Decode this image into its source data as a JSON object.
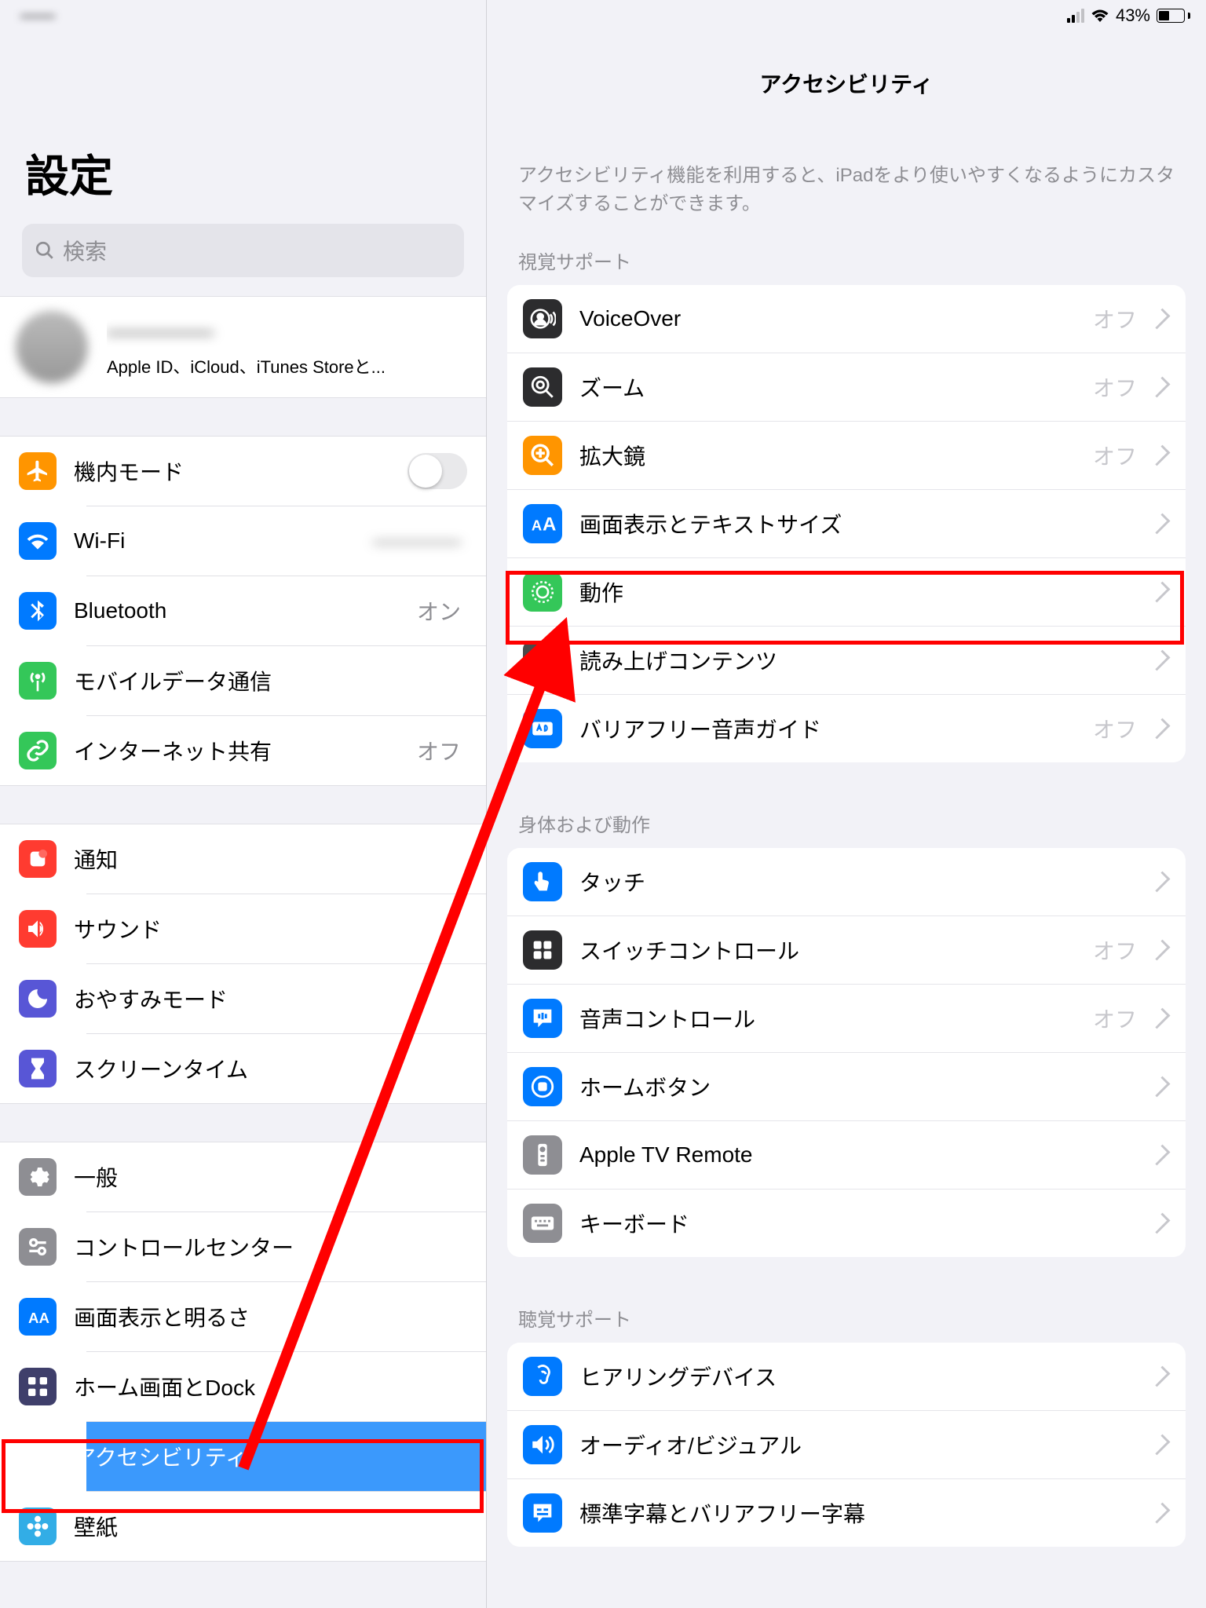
{
  "status": {
    "time": "——",
    "battery_pct": "43%"
  },
  "sidebar": {
    "title": "設定",
    "search_placeholder": "検索",
    "account": {
      "name": "————",
      "subtitle": "Apple ID、iCloud、iTunes Storeと..."
    },
    "groups": [
      {
        "items": [
          {
            "key": "airplane",
            "label": "機内モード",
            "icon": "airplane-icon",
            "color": "ic-orange",
            "type": "toggle"
          },
          {
            "key": "wifi",
            "label": "Wi-Fi",
            "icon": "wifi-icon",
            "color": "ic-blue",
            "value": "————",
            "value_blur": true
          },
          {
            "key": "bluetooth",
            "label": "Bluetooth",
            "icon": "bluetooth-icon",
            "color": "ic-blue",
            "value": "オン"
          },
          {
            "key": "cellular",
            "label": "モバイルデータ通信",
            "icon": "antenna-icon",
            "color": "ic-green"
          },
          {
            "key": "hotspot",
            "label": "インターネット共有",
            "icon": "link-icon",
            "color": "ic-green",
            "value": "オフ"
          }
        ]
      },
      {
        "items": [
          {
            "key": "notifications",
            "label": "通知",
            "icon": "bell-icon",
            "color": "ic-red"
          },
          {
            "key": "sound",
            "label": "サウンド",
            "icon": "speaker-icon",
            "color": "ic-red"
          },
          {
            "key": "dnd",
            "label": "おやすみモード",
            "icon": "moon-icon",
            "color": "ic-purple"
          },
          {
            "key": "screentime",
            "label": "スクリーンタイム",
            "icon": "hourglass-icon",
            "color": "ic-purple"
          }
        ]
      },
      {
        "items": [
          {
            "key": "general",
            "label": "一般",
            "icon": "gear-icon",
            "color": "ic-gray"
          },
          {
            "key": "controlcenter",
            "label": "コントロールセンター",
            "icon": "switches-icon",
            "color": "ic-gray"
          },
          {
            "key": "display",
            "label": "画面表示と明るさ",
            "icon": "text-icon",
            "color": "ic-blue"
          },
          {
            "key": "home",
            "label": "ホーム画面とDock",
            "icon": "grid-icon",
            "color": "ic-navy"
          },
          {
            "key": "accessibility",
            "label": "アクセシビリティ",
            "icon": "person-icon",
            "color": "ic-blue",
            "selected": true
          },
          {
            "key": "wallpaper",
            "label": "壁紙",
            "icon": "flower-icon",
            "color": "ic-teal"
          }
        ]
      }
    ]
  },
  "main": {
    "title": "アクセシビリティ",
    "description": "アクセシビリティ機能を利用すると、iPadをより使いやすくなるようにカスタマイズすることができます。",
    "groups": [
      {
        "header": "視覚サポート",
        "items": [
          {
            "key": "voiceover",
            "label": "VoiceOver",
            "icon": "voiceover-icon",
            "color": "ic-black",
            "value": "オフ"
          },
          {
            "key": "zoom",
            "label": "ズーム",
            "icon": "zoom-icon",
            "color": "ic-black",
            "value": "オフ"
          },
          {
            "key": "magnifier",
            "label": "拡大鏡",
            "icon": "magnifier-icon",
            "color": "ic-orange",
            "value": "オフ"
          },
          {
            "key": "textsize",
            "label": "画面表示とテキストサイズ",
            "icon": "textsize-icon",
            "color": "ic-blue"
          },
          {
            "key": "motion",
            "label": "動作",
            "icon": "motion-icon",
            "color": "ic-green",
            "highlight": true
          },
          {
            "key": "spoken",
            "label": "読み上げコンテンツ",
            "icon": "speech-icon",
            "color": "ic-darkgray"
          },
          {
            "key": "audiodesc",
            "label": "バリアフリー音声ガイド",
            "icon": "audio-desc-icon",
            "color": "ic-blue",
            "value": "オフ"
          }
        ]
      },
      {
        "header": "身体および動作",
        "items": [
          {
            "key": "touch",
            "label": "タッチ",
            "icon": "touch-icon",
            "color": "ic-blue"
          },
          {
            "key": "switch",
            "label": "スイッチコントロール",
            "icon": "switch-icon",
            "color": "ic-black",
            "value": "オフ"
          },
          {
            "key": "voice",
            "label": "音声コントロール",
            "icon": "voice-icon",
            "color": "ic-blue",
            "value": "オフ"
          },
          {
            "key": "homebtn",
            "label": "ホームボタン",
            "icon": "home-btn-icon",
            "color": "ic-blue"
          },
          {
            "key": "appletv",
            "label": "Apple TV Remote",
            "icon": "remote-icon",
            "color": "ic-gray"
          },
          {
            "key": "keyboard",
            "label": "キーボード",
            "icon": "keyboard-icon",
            "color": "ic-gray"
          }
        ]
      },
      {
        "header": "聴覚サポート",
        "items": [
          {
            "key": "hearing",
            "label": "ヒアリングデバイス",
            "icon": "ear-icon",
            "color": "ic-blue"
          },
          {
            "key": "audioviz",
            "label": "オーディオ/ビジュアル",
            "icon": "av-icon",
            "color": "ic-blue"
          },
          {
            "key": "captions",
            "label": "標準字幕とバリアフリー字幕",
            "icon": "caption-icon",
            "color": "ic-blue"
          }
        ]
      }
    ]
  }
}
